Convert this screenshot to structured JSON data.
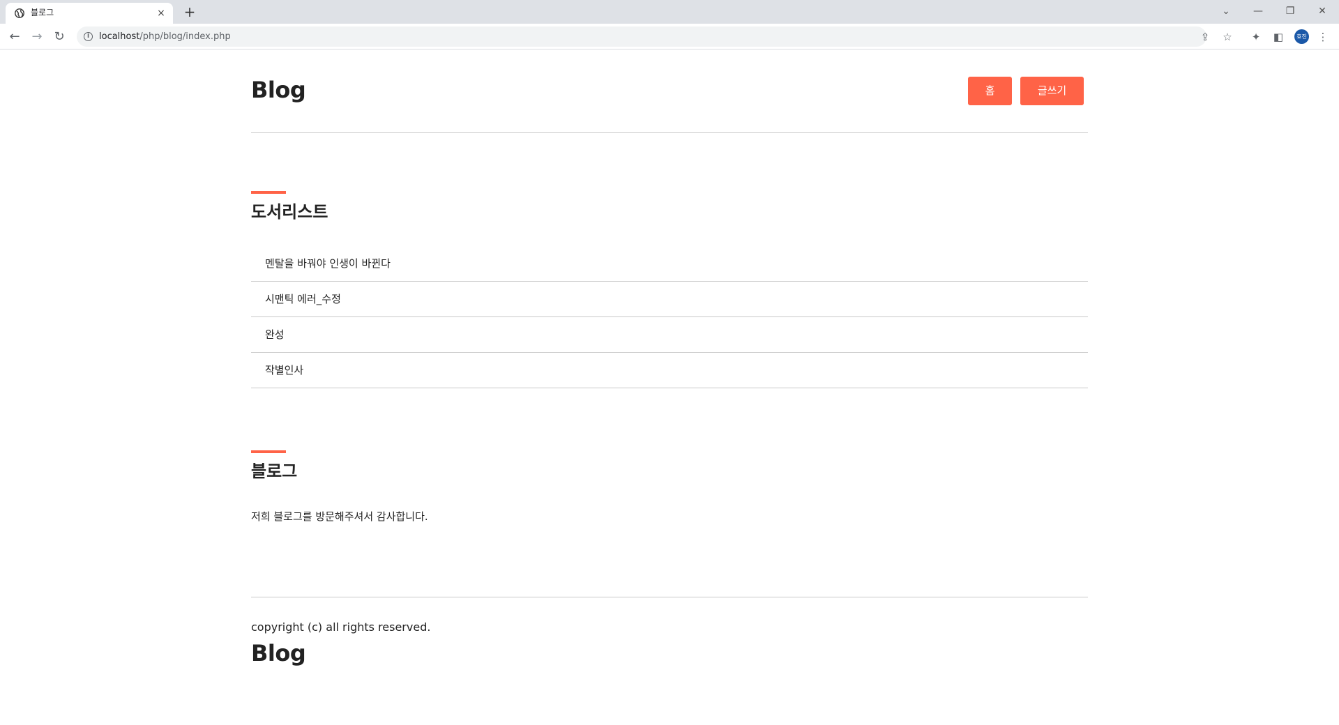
{
  "browser": {
    "tab_title": "블로그",
    "tab_close": "×",
    "new_tab": "+",
    "url_host": "localhost",
    "url_path": "/php/blog/index.php",
    "profile_initials": "효진"
  },
  "header": {
    "brand": "Blog",
    "home_button": "홈",
    "write_button": "글쓰기"
  },
  "post_list": {
    "title": "도서리스트",
    "items": [
      "멘탈을 바꿔야 인생이 바뀐다",
      "시맨틱 에러_수정",
      "완성",
      "작별인사"
    ]
  },
  "about": {
    "title": "블로그",
    "text": "저희 블로그를 방문해주셔서 감사합니다."
  },
  "footer": {
    "copyright": "copyright (c) all rights reserved.",
    "brand": "Blog"
  },
  "colors": {
    "accent": "#ff6347",
    "divider": "#c8c8c8",
    "tabbar": "#dee1e6"
  },
  "icons": [
    "globe-icon",
    "close-icon",
    "plus-icon",
    "back-icon",
    "forward-icon",
    "reload-icon",
    "info-icon",
    "share-icon",
    "star-icon",
    "extensions-icon",
    "sidepanel-icon",
    "menu-icon"
  ]
}
